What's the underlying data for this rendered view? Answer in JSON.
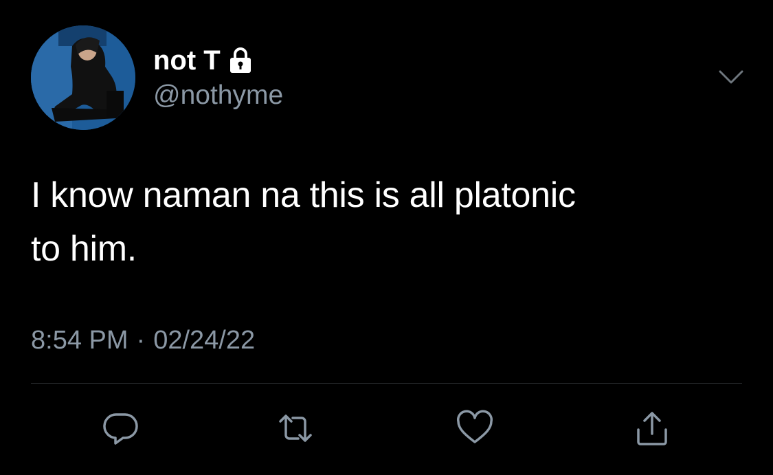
{
  "tweet": {
    "display_name": "not T",
    "handle": "@nothyme",
    "text": "I know naman na this is all platonic\nto him.",
    "time": "8:54 PM",
    "separator": "·",
    "date": "02/24/22",
    "protected_icon": "lock-icon",
    "menu_icon": "chevron-down-icon"
  },
  "actions": [
    {
      "name": "reply",
      "icon": "reply-icon"
    },
    {
      "name": "retweet",
      "icon": "retweet-icon"
    },
    {
      "name": "like",
      "icon": "heart-icon"
    },
    {
      "name": "share",
      "icon": "share-icon"
    }
  ],
  "colors": {
    "background": "#000000",
    "primary_text": "#ffffff",
    "secondary_text": "#8b98a5",
    "divider": "#2f3336",
    "icon": "#8b98a5"
  }
}
